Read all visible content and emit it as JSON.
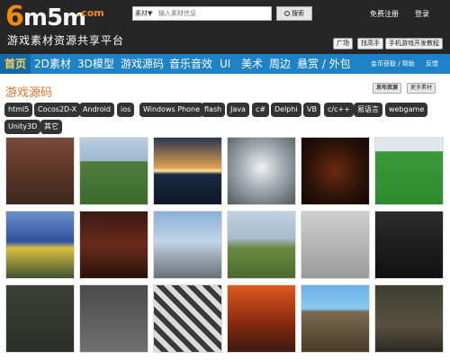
{
  "header": {
    "logo_main": "6m5m",
    "logo_com": ".com",
    "logo_sub": "游戏素材资源共享平台",
    "search_type": "素材▼",
    "search_placeholder": "输入素材信息",
    "search_button": "搜索",
    "register": "免费注册",
    "login": "登录",
    "buttons": [
      "广场",
      "找高手",
      "手机游戏开发教程"
    ]
  },
  "nav": {
    "items": [
      "首页",
      "2D素材",
      "3D模型",
      "游戏源码",
      "音乐音效",
      "UI",
      "美术",
      "周边",
      "悬赏 / 外包"
    ],
    "right_links": [
      "金币获取 / 帮助",
      "反馈"
    ]
  },
  "section": {
    "title": "游戏源码",
    "publish_button": "发布资源",
    "more_button": "更多素材"
  },
  "tags": [
    "html5",
    "Cocos2D-X",
    "Android",
    "ios",
    "Windows Phone",
    "flash",
    "Java",
    "c#",
    "Delphi",
    "VB",
    "c/c++",
    "易语言",
    "webgame",
    "Unity3D",
    "其它"
  ],
  "thumbnails": [
    {
      "name": "hut-scene",
      "bg": "linear-gradient(180deg,#7a4a3a 0%,#5a3325 55%,#3a2a20 100%)"
    },
    {
      "name": "tank-field",
      "bg": "linear-gradient(180deg,#b9cfe0 0%,#9db8cf 35%,#4f7d3c 36%,#3c6a2d 100%)"
    },
    {
      "name": "sunset-sea",
      "bg": "linear-gradient(180deg,#2a3550 0%,#e0a050 45%,#ffe6a0 50%,#1a2a40 55%,#0d1828 100%)"
    },
    {
      "name": "cloudy-sky",
      "bg": "radial-gradient(circle at 50% 45%,#f2f2f2 0%,#a0a8b0 45%,#505860 100%)"
    },
    {
      "name": "rpg-logo",
      "bg": "radial-gradient(circle at 50% 50%,#6a2a10 0%,#2a1208 60%,#120805 100%)"
    },
    {
      "name": "editor-field",
      "bg": "linear-gradient(180deg,#dfe6ee 0%,#dfe6ee 20%,#3a9a3a 21%,#2e8a2e 100%)"
    },
    {
      "name": "arena-room",
      "bg": "linear-gradient(180deg,#6a90c8 0%,#3050a0 45%,#d8c040 55%,#405030 100%)"
    },
    {
      "name": "dungeon",
      "bg": "linear-gradient(180deg,#3a1a12 0%,#6a2a1a 50%,#2a120a 100%)"
    },
    {
      "name": "snow-terrain",
      "bg": "linear-gradient(180deg,#8ab0d8 0%,#c0d4e8 45%,#9aa4ae 70%,#6a7078 100%)"
    },
    {
      "name": "grass-hills",
      "bg": "linear-gradient(180deg,#c0d0e0 0%,#a8bccc 40%,#6a8a40 55%,#4a6a30 100%)"
    },
    {
      "name": "item-box",
      "bg": "linear-gradient(180deg,#cfcfcf 0%,#9a9a9a 100%)"
    },
    {
      "name": "chain",
      "bg": "linear-gradient(180deg,#2c2c2c 0%,#101010 100%)"
    },
    {
      "name": "mech-topdown",
      "bg": "linear-gradient(180deg,#3a4038 0%,#2a3028 100%)"
    },
    {
      "name": "dialog-ui",
      "bg": "linear-gradient(180deg,#4a4a4a 0%,#707070 100%)"
    },
    {
      "name": "checker-robot",
      "bg": "repeating-linear-gradient(45deg,#dcdcdc 0 6px,#3a3a3a 6px 12px)"
    },
    {
      "name": "warrior-art",
      "bg": "linear-gradient(180deg,#e05a20 0%,#8a2a10 55%,#3a1a10 100%)"
    },
    {
      "name": "pit-scene",
      "bg": "linear-gradient(180deg,#6ab0e8 0%,#8ac8f0 35%,#7a6a50 40%,#4a3a28 100%)"
    },
    {
      "name": "battle-scene",
      "bg": "linear-gradient(180deg,#3a4030 0%,#5a5040 60%,#2a2a20 100%)"
    }
  ]
}
